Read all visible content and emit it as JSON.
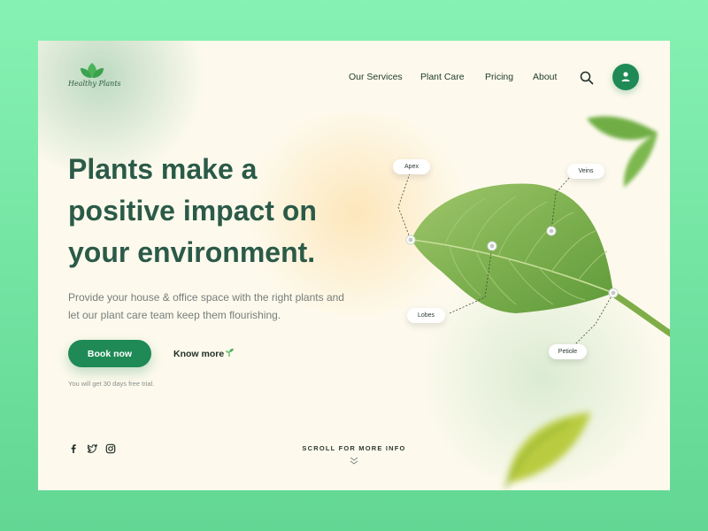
{
  "brand": {
    "name": "Healthy Plants",
    "logo_icon": "leaf-cluster-icon"
  },
  "nav": {
    "items": [
      {
        "label": "Our Services"
      },
      {
        "label": "Plant Care"
      },
      {
        "label": "Pricing"
      },
      {
        "label": "About"
      }
    ],
    "search_icon": "search-icon",
    "profile_icon": "user-icon"
  },
  "hero": {
    "title": "Plants make a positive impact on your environment.",
    "subtitle": "Provide your house & office space with the right plants and let our plant care team keep them flourishing.",
    "primary_button": "Book now",
    "secondary_link": "Know more",
    "trial_note": "You will get 30 days free trial."
  },
  "leaf_labels": {
    "apex": "Apex",
    "veins": "Veins",
    "lobes": "Lobes",
    "petiole": "Petiole"
  },
  "social": [
    "facebook-icon",
    "twitter-icon",
    "instagram-icon"
  ],
  "scroll_hint": "SCROLL FOR MORE INFO",
  "colors": {
    "page_background": "#7ae8a8",
    "card_background": "#fdfaed",
    "accent_green": "#1f8a56",
    "heading_green": "#2b5a48"
  }
}
